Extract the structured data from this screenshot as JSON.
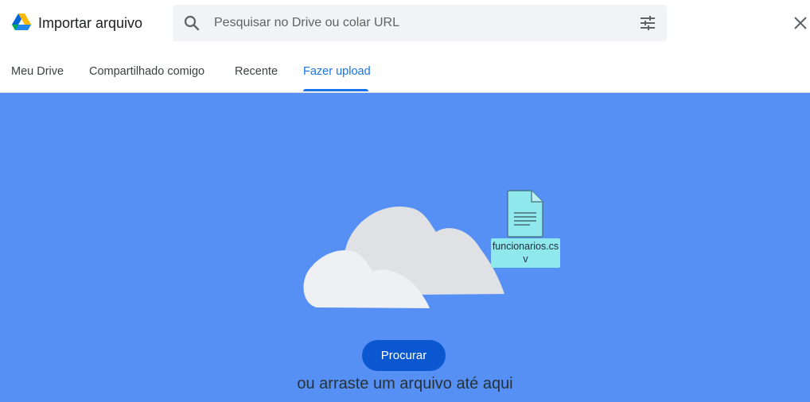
{
  "header": {
    "title": "Importar arquivo",
    "logo_icon": "google-drive-logo",
    "close_icon": "close-icon"
  },
  "search": {
    "placeholder": "Pesquisar no Drive ou colar URL",
    "value": "",
    "search_icon": "search-icon",
    "filter_icon": "tune-icon"
  },
  "tabs": [
    {
      "label": "Meu Drive",
      "active": false
    },
    {
      "label": "Compartilhado comigo",
      "active": false
    },
    {
      "label": "Recente",
      "active": false
    },
    {
      "label": "Fazer upload",
      "active": true
    }
  ],
  "upload": {
    "dragged_file_name": "funcionarios.csv",
    "browse_label": "Procurar",
    "drag_hint": "ou arraste um arquivo até aqui"
  },
  "colors": {
    "accent": "#1a73e8",
    "dropzone_bg": "#5690f4",
    "button_bg": "#0b57d0",
    "file_label_bg": "#8ee8ec"
  }
}
